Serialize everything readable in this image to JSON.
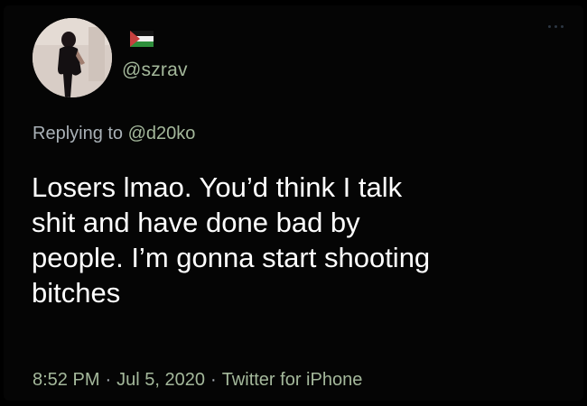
{
  "user": {
    "handle": "@szrav",
    "flag_icon": "palestine-flag-icon",
    "avatar": "profile-photo-avatar"
  },
  "reply": {
    "prefix": "Replying to",
    "mention": "@d20ko"
  },
  "tweet": {
    "lines": [
      "Losers lmao. You’d think I talk",
      "shit and have done bad by",
      "people. I’m gonna start shooting",
      "bitches"
    ]
  },
  "meta": {
    "time": "8:52 PM",
    "date": "Jul 5, 2020",
    "source": "Twitter for iPhone",
    "separator": "·"
  },
  "colors": {
    "background": "#000000",
    "accent": "#a4b89b",
    "text": "#ffffff",
    "muted": "#a9b1b7",
    "flag_red": "#c8413f",
    "flag_green": "#2f8f3c"
  }
}
